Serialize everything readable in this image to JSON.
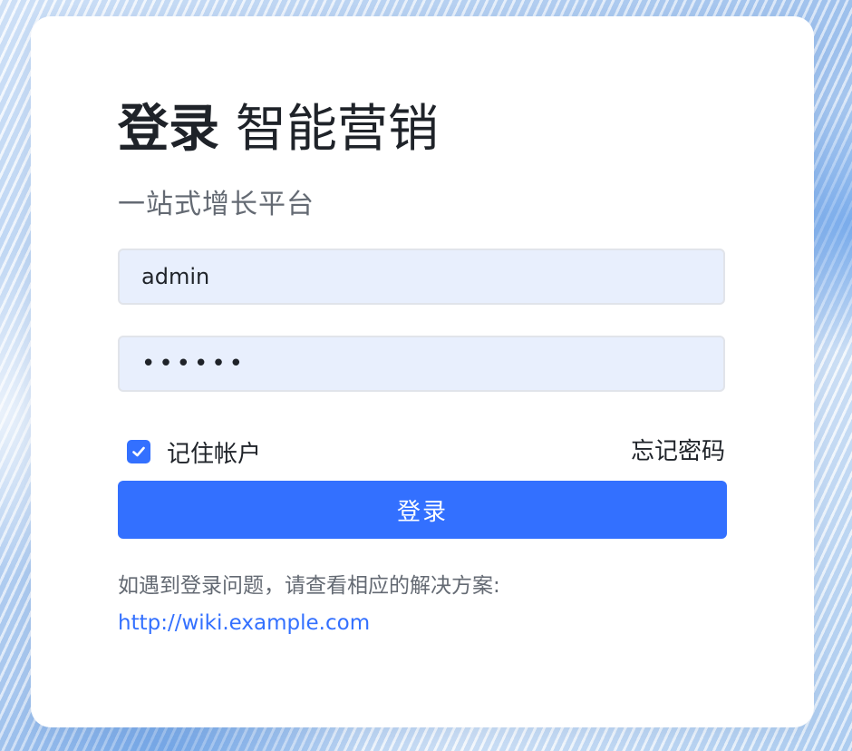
{
  "header": {
    "title_strong": "登录",
    "title_rest": "智能营销",
    "subtitle": "一站式增长平台"
  },
  "form": {
    "username_value": "admin",
    "password_value": "••••••",
    "remember_label": "记住帐户",
    "remember_checked": true,
    "forgot_label": "忘记密码",
    "submit_label": "登录"
  },
  "help": {
    "text": "如遇到登录问题，请查看相应的解决方案:",
    "link_text": "http://wiki.example.com"
  },
  "colors": {
    "accent": "#3370ff",
    "input_bg": "#e8effd",
    "text_primary": "#1f2329",
    "text_secondary": "#646a73"
  }
}
